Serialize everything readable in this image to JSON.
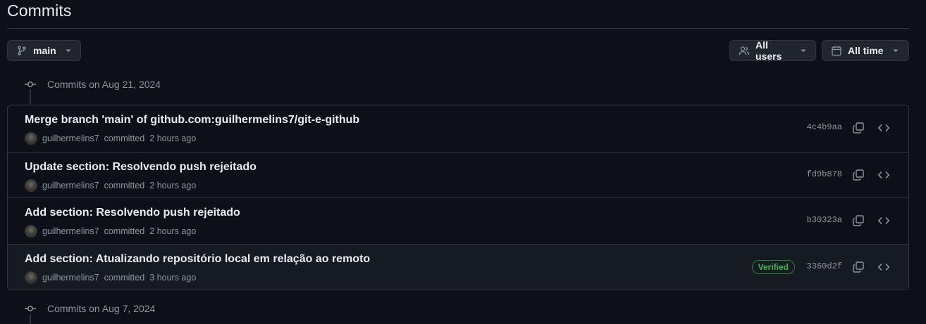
{
  "page": {
    "title": "Commits"
  },
  "filters": {
    "branch": "main",
    "users": "All users",
    "time": "All time"
  },
  "groups": [
    {
      "label": "Commits on Aug 21, 2024",
      "commits": [
        {
          "message": "Merge branch 'main' of github.com:guilhermelins7/git-e-github",
          "author": "guilhermelins7",
          "action": "committed",
          "time": "2 hours ago",
          "sha": "4c4b9aa",
          "verified": ""
        },
        {
          "message": "Update section: Resolvendo push rejeitado",
          "author": "guilhermelins7",
          "action": "committed",
          "time": "2 hours ago",
          "sha": "fd9b878",
          "verified": ""
        },
        {
          "message": "Add section: Resolvendo push rejeitado",
          "author": "guilhermelins7",
          "action": "committed",
          "time": "2 hours ago",
          "sha": "b30323a",
          "verified": ""
        },
        {
          "message": "Add section: Atualizando repositório local em relação ao remoto",
          "author": "guilhermelins7",
          "action": "committed",
          "time": "3 hours ago",
          "sha": "3360d2f",
          "verified": "Verified"
        }
      ]
    },
    {
      "label": "Commits on Aug 7, 2024"
    }
  ],
  "icons": {
    "branch": "git-branch-icon",
    "users": "people-icon",
    "time": "calendar-icon",
    "copy": "copy-icon",
    "browse": "code-icon",
    "node": "git-commit-icon"
  },
  "colors": {
    "background": "#0d1117",
    "border": "#30363d",
    "text": "#e6edf3",
    "muted": "#8d96a0",
    "verified": "#3fb950"
  }
}
